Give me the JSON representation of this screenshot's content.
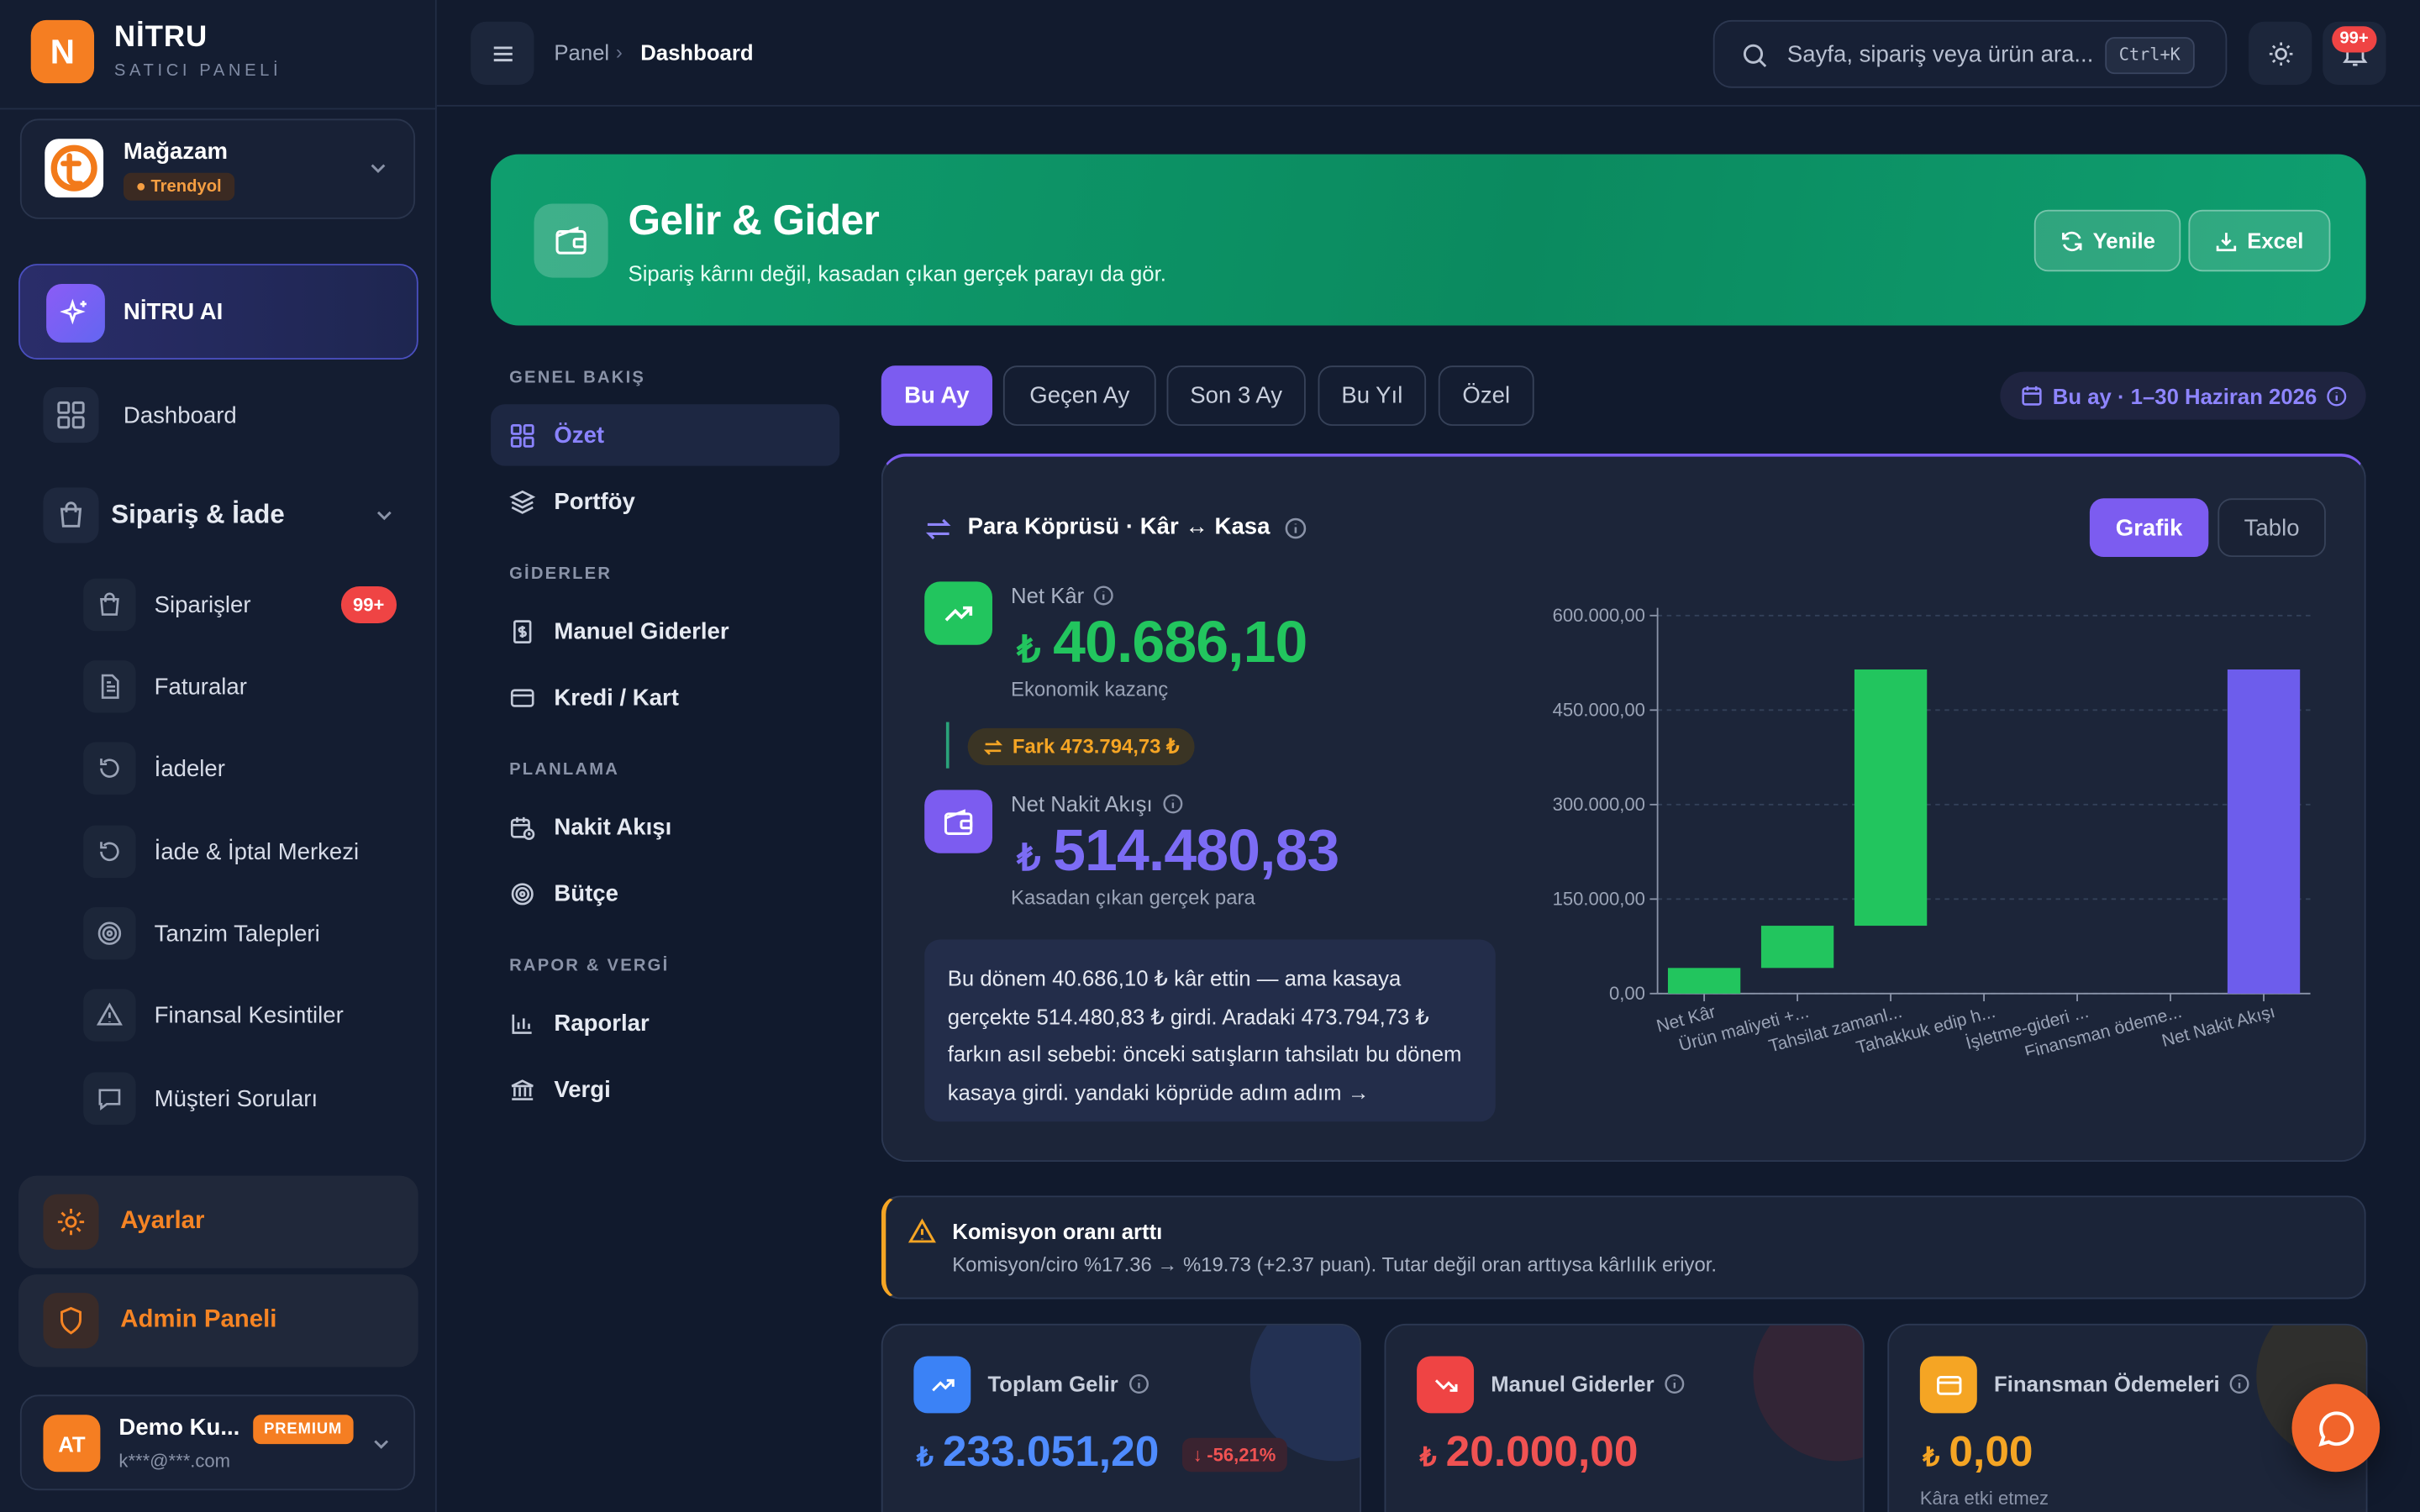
{
  "brand": {
    "name": "NİTRU",
    "subtitle": "SATICI PANELİ",
    "logo_letter": "N",
    "accent": "#f57e22"
  },
  "store": {
    "name": "Mağazam",
    "platform": "Trendyol"
  },
  "ai": {
    "label": "NİTRU AI"
  },
  "sidebar": {
    "dashboard": "Dashboard",
    "group": "Sipariş & İade",
    "items": [
      {
        "label": "Siparişler",
        "badge": "99+",
        "icon": "shopping-bag-icon"
      },
      {
        "label": "Faturalar",
        "icon": "document-icon"
      },
      {
        "label": "İadeler",
        "icon": "return-icon"
      },
      {
        "label": "İade & İptal Merkezi",
        "icon": "return-icon"
      },
      {
        "label": "Tanzim Talepleri",
        "icon": "target-icon"
      },
      {
        "label": "Finansal Kesintiler",
        "icon": "warning-icon"
      },
      {
        "label": "Müşteri Soruları",
        "icon": "chat-icon"
      }
    ],
    "settings": "Ayarlar",
    "admin": "Admin Paneli"
  },
  "user": {
    "initials": "AT",
    "name": "Demo Ku...",
    "plan": "PREMIUM",
    "email": "k***@***.com"
  },
  "topbar": {
    "crumb1": "Panel",
    "crumb2": "Dashboard",
    "search_placeholder": "Sayfa, sipariş veya ürün ara...",
    "shortcut": "Ctrl+K",
    "notif_count": "99+"
  },
  "hero": {
    "title": "Gelir & Gider",
    "subtitle": "Sipariş kârını değil, kasadan çıkan gerçek parayı da gör.",
    "refresh": "Yenile",
    "excel": "Excel"
  },
  "submenu": {
    "sections": [
      {
        "title": "GENEL BAKIŞ",
        "items": [
          "Özet",
          "Portföy"
        ]
      },
      {
        "title": "GİDERLER",
        "items": [
          "Manuel Giderler",
          "Kredi / Kart"
        ]
      },
      {
        "title": "PLANLAMA",
        "items": [
          "Nakit Akışı",
          "Bütçe"
        ]
      },
      {
        "title": "RAPOR & VERGİ",
        "items": [
          "Raporlar",
          "Vergi"
        ]
      }
    ]
  },
  "periods": [
    "Bu Ay",
    "Geçen Ay",
    "Son 3 Ay",
    "Bu Yıl",
    "Özel"
  ],
  "active_period": "Bu Ay",
  "range_label": "Bu ay · 1–30 Haziran 2026",
  "bridge": {
    "title": "Para Köprüsü · Kâr ↔ Kasa",
    "toggle": [
      "Grafik",
      "Tablo"
    ],
    "net_profit": {
      "label": "Net Kâr",
      "currency": "₺",
      "value": "40.686,10",
      "caption": "Ekonomik kazanç"
    },
    "diff": "Fark 473.794,73 ₺",
    "net_cash": {
      "label": "Net Nakit Akışı",
      "currency": "₺",
      "value": "514.480,83",
      "caption": "Kasadan çıkan gerçek para"
    },
    "story": "Bu dönem 40.686,10 ₺ kâr ettin — ama kasaya gerçekte 514.480,83 ₺ girdi. Aradaki 473.794,73 ₺ farkın asıl sebebi: önceki satışların tahsilatı bu dönem kasaya girdi. yandaki köprüde adım adım →"
  },
  "chart_data": {
    "type": "bar",
    "subtype": "waterfall",
    "categories": [
      "Net Kâr",
      "Ürün maliyeti +...",
      "Tahsilat zamanl...",
      "Tahakkuk edip h...",
      "İşletme-gideri ...",
      "Finansman ödeme...",
      "Net Nakit Akışı"
    ],
    "values": [
      40686.1,
      67000,
      406794.73,
      0,
      0,
      0,
      514480.83
    ],
    "cumulative": [
      40686.1,
      107686.1,
      514480.83,
      514480.83,
      514480.83,
      514480.83,
      514480.83
    ],
    "y_ticks": [
      "0,00",
      "150.000,00",
      "300.000,00",
      "450.000,00",
      "600.000,00"
    ],
    "ylim": [
      0,
      600000
    ],
    "grid": true,
    "colors": {
      "step": "#22c55e",
      "total": "#6d5dec"
    }
  },
  "alert": {
    "title": "Komisyon oranı arttı",
    "text": "Komisyon/ciro %17.36 → %19.73 (+2.37 puan). Tutar değil oran arttıysa kârlılık eriyor."
  },
  "kpis": [
    {
      "label": "Toplam Gelir",
      "currency": "₺",
      "value": "233.051,20",
      "delta": "-56,21%",
      "color": "#4f8cff",
      "icon": "trend-up-icon"
    },
    {
      "label": "Manuel Giderler",
      "currency": "₺",
      "value": "20.000,00",
      "color": "#ef4444",
      "icon": "trend-down-icon"
    },
    {
      "label": "Finansman Ödemeleri",
      "currency": "₺",
      "value": "0,00",
      "caption": "Kâra etki etmez",
      "color": "#f5a524",
      "icon": "credit-card-icon"
    }
  ]
}
